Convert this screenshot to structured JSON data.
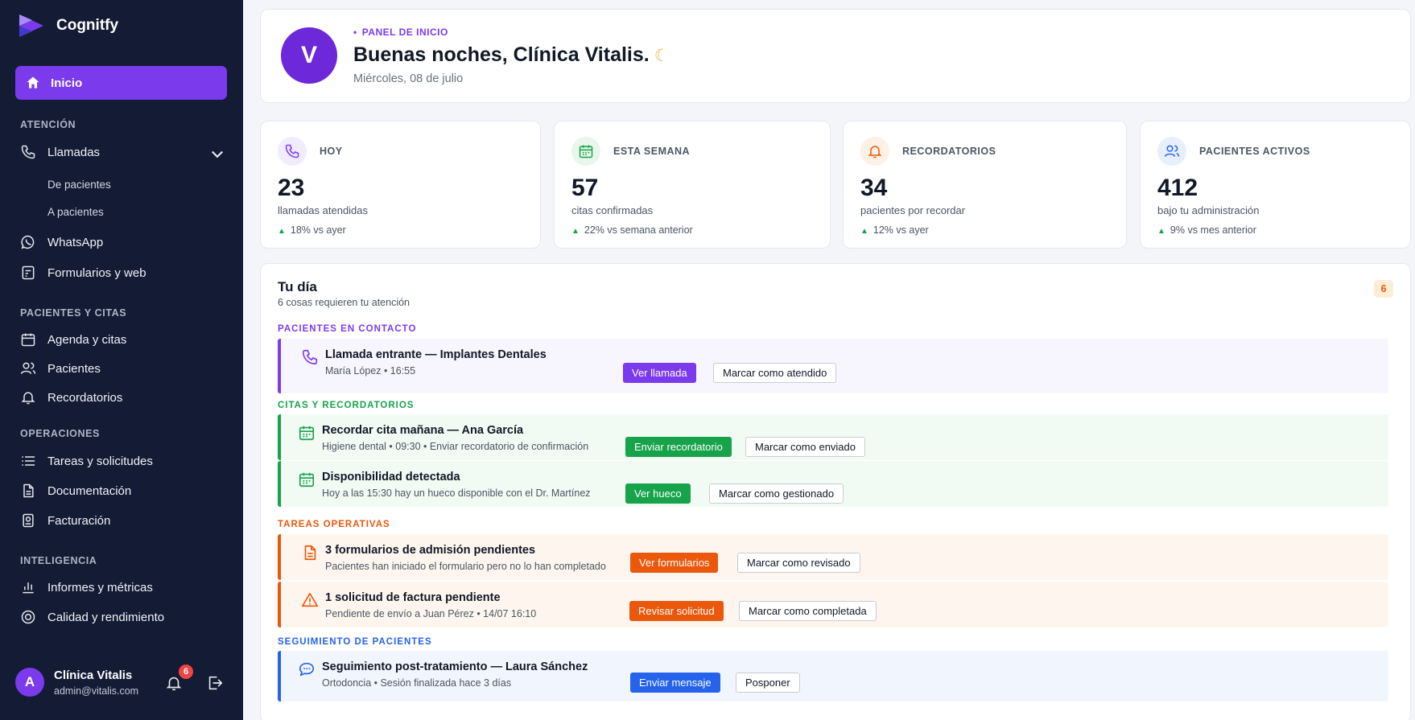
{
  "app": {
    "name": "Cognitfy"
  },
  "sidebar": {
    "home_label": "Inicio",
    "sections": {
      "atencion": "ATENCIÓN",
      "pacientes_citas": "PACIENTES Y CITAS",
      "operaciones": "OPERACIONES",
      "inteligencia": "INTELIGENCIA"
    },
    "items": {
      "llamadas": "Llamadas",
      "de_pacientes": "De pacientes",
      "a_pacientes": "A pacientes",
      "whatsapp": "WhatsApp",
      "formularios": "Formularios y web",
      "agenda": "Agenda y citas",
      "pacientes": "Pacientes",
      "recordatorios": "Recordatorios",
      "tareas": "Tareas y solicitudes",
      "documentacion": "Documentación",
      "facturacion": "Facturación",
      "informes": "Informes y métricas",
      "calidad": "Calidad y rendimiento"
    },
    "user": {
      "initial": "A",
      "name": "Clínica Vitalis",
      "email": "admin@vitalis.com",
      "notifications": "6"
    }
  },
  "header": {
    "avatar_initial": "V",
    "kicker": "PANEL DE INICIO",
    "greeting": "Buenas noches, Clínica Vitalis.",
    "date": "Miércoles, 08 de julio"
  },
  "stats": [
    {
      "label": "HOY",
      "value": "23",
      "desc": "llamadas atendidas",
      "trend": "18% vs ayer",
      "icon": "phone-icon",
      "color": "#7c3aed"
    },
    {
      "label": "ESTA SEMANA",
      "value": "57",
      "desc": "citas confirmadas",
      "trend": "22% vs semana anterior",
      "icon": "calendar-icon",
      "color": "#16a34a"
    },
    {
      "label": "RECORDATORIOS",
      "value": "34",
      "desc": "pacientes por recordar",
      "trend": "12% vs ayer",
      "icon": "bell-icon",
      "color": "#ea580c"
    },
    {
      "label": "PACIENTES ACTIVOS",
      "value": "412",
      "desc": "bajo tu administración",
      "trend": "9% vs mes anterior",
      "icon": "users-icon",
      "color": "#2563eb"
    }
  ],
  "day": {
    "title": "Tu día",
    "subtitle": "6 cosas requieren tu atención",
    "count": "6",
    "groups": {
      "contacto": "PACIENTES EN CONTACTO",
      "citas": "CITAS Y RECORDATORIOS",
      "tareas": "TAREAS OPERATIVAS",
      "seguimiento": "SEGUIMIENTO DE PACIENTES"
    },
    "tasks": [
      {
        "title": "Llamada entrante — Implantes Dentales",
        "meta": "María López • 16:55",
        "primary": "Ver llamada",
        "secondary": "Marcar como atendido"
      },
      {
        "title": "Recordar cita mañana — Ana García",
        "meta": "Higiene dental • 09:30 • Enviar recordatorio de confirmación",
        "primary": "Enviar recordatorio",
        "secondary": "Marcar como enviado"
      },
      {
        "title": "Disponibilidad detectada",
        "meta": "Hoy a las 15:30 hay un hueco disponible con el Dr. Martínez",
        "primary": "Ver hueco",
        "secondary": "Marcar como gestionado"
      },
      {
        "title": "3 formularios de admisión pendientes",
        "meta": "Pacientes han iniciado el formulario pero no lo han completado",
        "primary": "Ver formularios",
        "secondary": "Marcar como revisado"
      },
      {
        "title": "1 solicitud de factura pendiente",
        "meta": "Pendiente de envío a Juan Pérez • 14/07 16:10",
        "primary": "Revisar solicitud",
        "secondary": "Marcar como completada"
      },
      {
        "title": "Seguimiento post-tratamiento — Laura Sánchez",
        "meta": "Ortodoncia • Sesión finalizada hace 3 días",
        "primary": "Enviar mensaje",
        "secondary": "Posponer"
      }
    ]
  },
  "colors": {
    "sidebar_bg": "#131b35",
    "accent_purple": "#7c3aed",
    "green": "#16a34a",
    "orange": "#ea580c",
    "blue": "#2563eb"
  }
}
